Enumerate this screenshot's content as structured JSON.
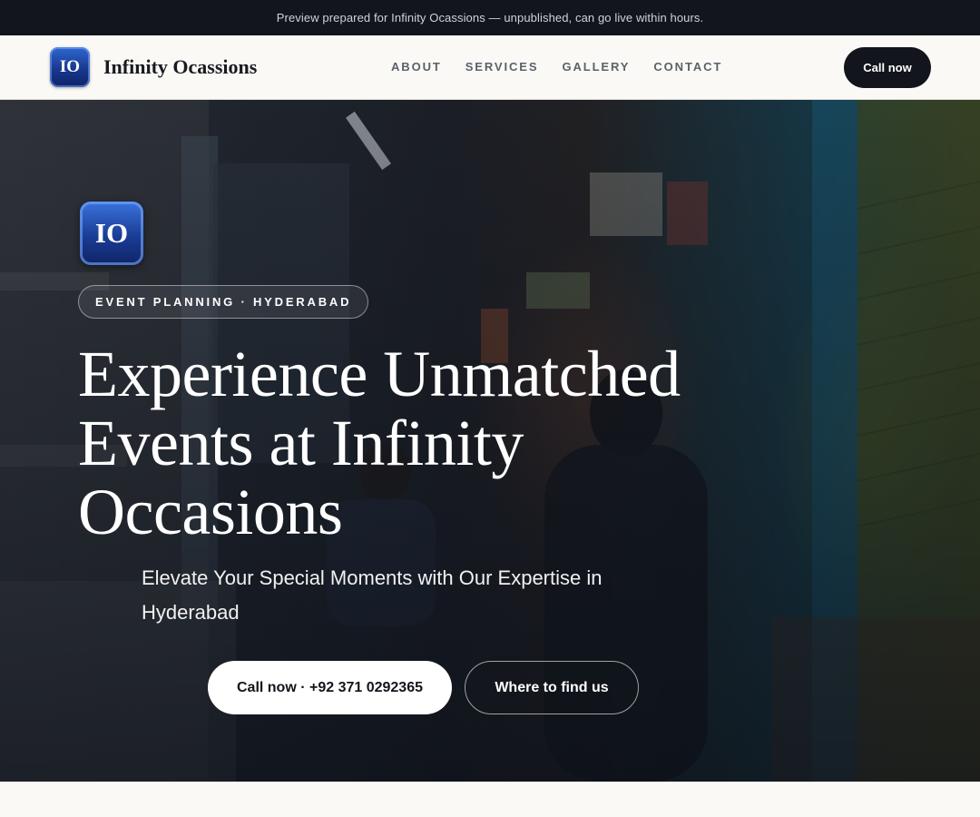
{
  "banner": {
    "text": "Preview prepared for Infinity Ocassions — unpublished, can go live within hours."
  },
  "header": {
    "logo_text": "IO",
    "brand_name": "Infinity Ocassions",
    "nav": [
      {
        "label": "ABOUT"
      },
      {
        "label": "SERVICES"
      },
      {
        "label": "GALLERY"
      },
      {
        "label": "CONTACT"
      }
    ],
    "cta_label": "Call now"
  },
  "hero": {
    "logo_text": "IO",
    "eyebrow": "EVENT PLANNING · HYDERABAD",
    "title": "Experience Unmatched Events at Infinity Occasions",
    "subtitle": "Elevate Your Special Moments with Our Expertise in Hyderabad",
    "primary_cta": "Call now · +92 371 0292365",
    "secondary_cta": "Where to find us"
  },
  "colors": {
    "dark": "#12151b",
    "logo_blue": "#17358a",
    "page_bg": "#faf9f6"
  }
}
